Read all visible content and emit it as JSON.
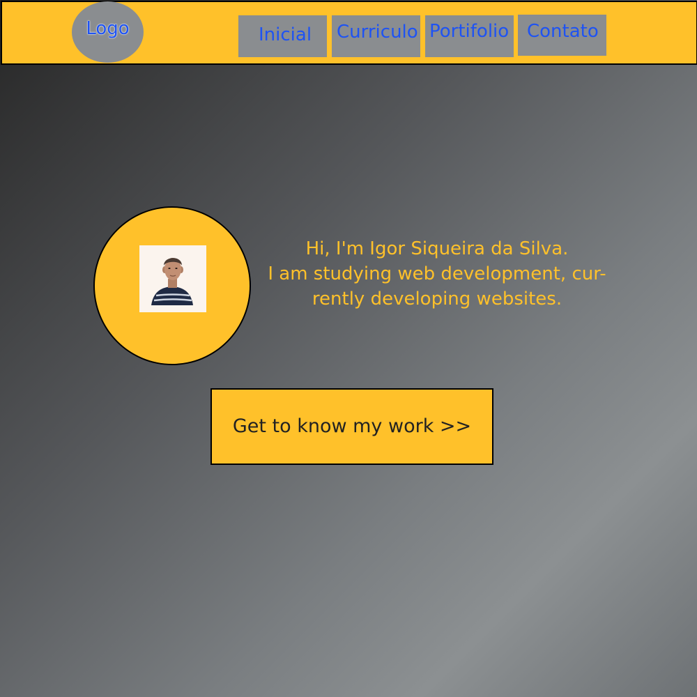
{
  "header": {
    "logo": "Logo",
    "nav": {
      "inicial": "Inicial",
      "curriculo": "Curriculo",
      "portifolio": "Portifolio",
      "contato": "Contato"
    }
  },
  "hero": {
    "greeting": "Hi, I'm Igor Siqueira da Silva.",
    "line2": "I am studying web development, cur-",
    "line3": "rently developing websites.",
    "cta_label": "Get to know my work >>"
  },
  "colors": {
    "accent": "#ffc12a",
    "link": "#1e53f3",
    "nav_background": "#8a8d90",
    "border": "#000000"
  }
}
